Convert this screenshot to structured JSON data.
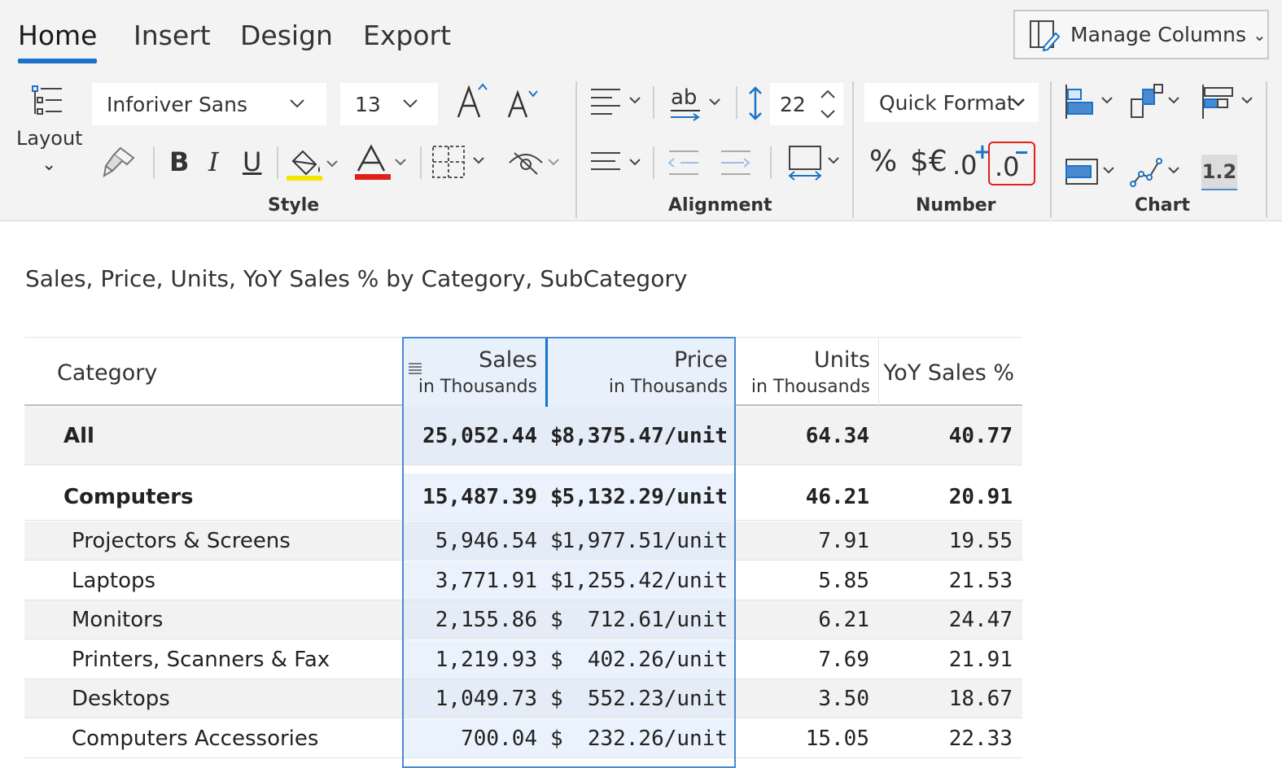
{
  "ribbon": {
    "tabs": [
      {
        "label": "Home"
      },
      {
        "label": "Insert"
      },
      {
        "label": "Design"
      },
      {
        "label": "Export"
      }
    ],
    "manage_columns_label": "Manage Columns",
    "layout_label": "Layout",
    "font_family": "Inforiver Sans",
    "font_size": "13",
    "row_height": "22",
    "quick_format_label": "Quick Format",
    "number_buttons": {
      "percent": "%",
      "currency": "$€",
      "inc_decimal": ".0",
      "dec_decimal": ".0"
    },
    "chart_value_label": "1.2",
    "groups": {
      "style": "Style",
      "alignment": "Alignment",
      "number": "Number",
      "chart": "Chart"
    },
    "colors": {
      "accent": "#1a73c8",
      "highlight_yellow": "#f2e600",
      "font_red": "#e0201b",
      "highlight_box": "#e0201b"
    }
  },
  "report": {
    "title": "Sales, Price, Units, YoY Sales % by Category, SubCategory",
    "columns": [
      {
        "main": "Category",
        "sub": ""
      },
      {
        "main": "Sales",
        "sub": "in Thousands"
      },
      {
        "main": "Price",
        "sub": "in Thousands"
      },
      {
        "main": "Units",
        "sub": "in Thousands"
      },
      {
        "main": "YoY Sales %",
        "sub": ""
      }
    ],
    "rows": [
      {
        "label": "All",
        "sales": "25,052.44",
        "price_cur": "$",
        "price": "8,375.47/unit",
        "units": "64.34",
        "yoy": "40.77"
      },
      {
        "label": "Computers",
        "sales": "15,487.39",
        "price_cur": "$",
        "price": "5,132.29/unit",
        "units": "46.21",
        "yoy": "20.91"
      },
      {
        "label": "Projectors & Screens",
        "sales": "5,946.54",
        "price_cur": "$",
        "price": "1,977.51/unit",
        "units": "7.91",
        "yoy": "19.55"
      },
      {
        "label": "Laptops",
        "sales": "3,771.91",
        "price_cur": "$",
        "price": "1,255.42/unit",
        "units": "5.85",
        "yoy": "21.53"
      },
      {
        "label": "Monitors",
        "sales": "2,155.86",
        "price_cur": "$",
        "price": "712.61/unit",
        "units": "6.21",
        "yoy": "24.47"
      },
      {
        "label": "Printers, Scanners & Fax",
        "sales": "1,219.93",
        "price_cur": "$",
        "price": "402.26/unit",
        "units": "7.69",
        "yoy": "21.91"
      },
      {
        "label": "Desktops",
        "sales": "1,049.73",
        "price_cur": "$",
        "price": "552.23/unit",
        "units": "3.50",
        "yoy": "18.67"
      },
      {
        "label": "Computers Accessories",
        "sales": "700.04",
        "price_cur": "$",
        "price": "232.26/unit",
        "units": "15.05",
        "yoy": "22.33"
      }
    ]
  }
}
